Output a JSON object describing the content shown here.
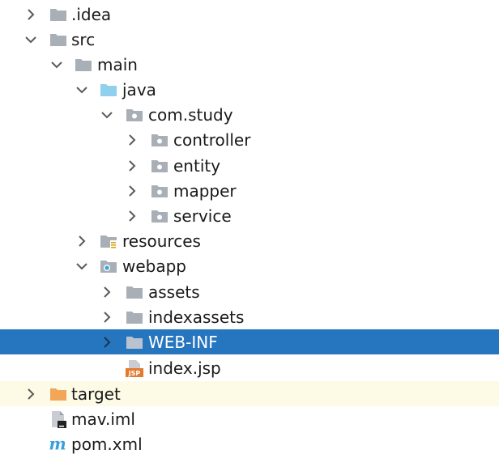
{
  "colors": {
    "selection_bg": "#2675bf",
    "excluded_row_bg": "#fdfbe6",
    "folder_gray": "#a9afb7",
    "source_folder_blue": "#8fd0ef",
    "excluded_folder_orange": "#f2a65a",
    "package_dot": "#ffffff",
    "web_dot": "#3aa6d6",
    "maven_blue": "#3a9ee0"
  },
  "project_tree": {
    "items": [
      {
        "label": ".idea",
        "icon": "folder-icon",
        "expandable": true,
        "expanded": false
      },
      {
        "label": "src",
        "icon": "folder-icon",
        "expandable": true,
        "expanded": true
      },
      {
        "label": "main",
        "icon": "folder-icon",
        "expandable": true,
        "expanded": true
      },
      {
        "label": "java",
        "icon": "source-folder-icon",
        "expandable": true,
        "expanded": true
      },
      {
        "label": "com.study",
        "icon": "package-icon",
        "expandable": true,
        "expanded": true
      },
      {
        "label": "controller",
        "icon": "package-icon",
        "expandable": true,
        "expanded": false
      },
      {
        "label": "entity",
        "icon": "package-icon",
        "expandable": true,
        "expanded": false
      },
      {
        "label": "mapper",
        "icon": "package-icon",
        "expandable": true,
        "expanded": false
      },
      {
        "label": "service",
        "icon": "package-icon",
        "expandable": true,
        "expanded": false
      },
      {
        "label": "resources",
        "icon": "resources-folder-icon",
        "expandable": true,
        "expanded": false
      },
      {
        "label": "webapp",
        "icon": "web-folder-icon",
        "expandable": true,
        "expanded": true
      },
      {
        "label": "assets",
        "icon": "folder-icon",
        "expandable": true,
        "expanded": false
      },
      {
        "label": "indexassets",
        "icon": "folder-icon",
        "expandable": true,
        "expanded": false
      },
      {
        "label": "WEB-INF",
        "icon": "folder-icon",
        "expandable": true,
        "expanded": false,
        "selected": true
      },
      {
        "label": "index.jsp",
        "icon": "jsp-file-icon",
        "expandable": false
      },
      {
        "label": "target",
        "icon": "excluded-folder-icon",
        "expandable": true,
        "expanded": false,
        "excluded": true
      },
      {
        "label": "mav.iml",
        "icon": "iml-file-icon",
        "expandable": false
      },
      {
        "label": "pom.xml",
        "icon": "maven-icon",
        "expandable": false
      }
    ],
    "jsp_badge": "JSP",
    "maven_glyph": "m"
  }
}
